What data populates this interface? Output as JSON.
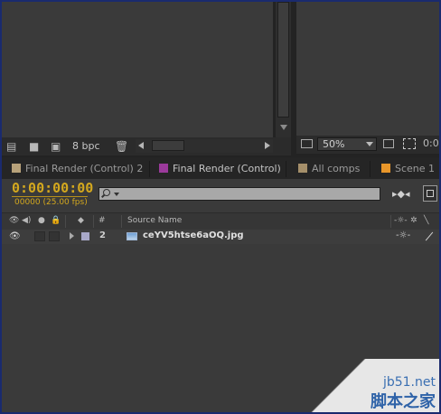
{
  "project": {
    "bpc": "8 bpc"
  },
  "viewer": {
    "zoom": "50%",
    "timecode_partial": "0:0"
  },
  "tabs": [
    {
      "label": "Final Render (Control) 2",
      "color": "#b8a27a"
    },
    {
      "label": "Final Render (Control)",
      "color": "#9b3a9b"
    },
    {
      "label": "All comps",
      "color": "#a58f6a"
    },
    {
      "label": "Scene 1",
      "color": "#e8962a"
    }
  ],
  "timeline": {
    "timecode": "0:00:00:00",
    "frames": "00000 (25.00 fps)",
    "columns": {
      "hash": "#",
      "source_name": "Source Name"
    },
    "layers": [
      {
        "number": "2",
        "name": "ceYV5htse6aOQ.jpg",
        "label_color": "#a8a8c8"
      }
    ]
  },
  "watermark": {
    "site": "jb51.net",
    "cn": "脚本之家"
  }
}
